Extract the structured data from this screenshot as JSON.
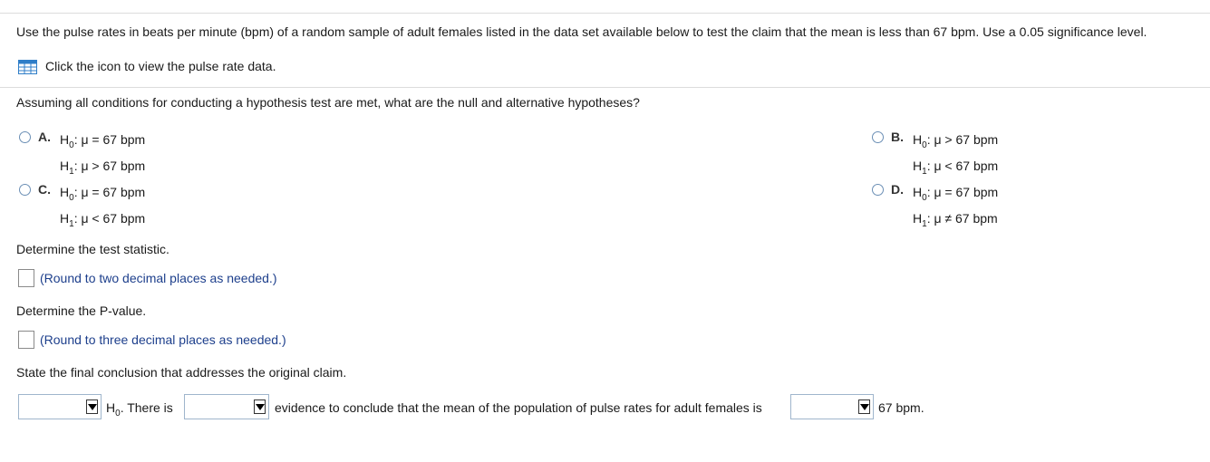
{
  "question": {
    "intro": "Use the pulse rates in beats per minute (bpm) of a random sample of adult females listed in the data set available below to test the claim that the mean is less than 67 bpm. Use a 0.05 significance level.",
    "data_link": "Click the icon to view the pulse rate data.",
    "data_icon": "table-grid-icon"
  },
  "part1": {
    "prompt": "Assuming all conditions for conducting a hypothesis test are met, what are the null and alternative hypotheses?",
    "options": [
      {
        "letter": "A.",
        "h0_rel": "μ = 67 bpm",
        "h1_rel": "μ > 67 bpm"
      },
      {
        "letter": "B.",
        "h0_rel": "μ > 67 bpm",
        "h1_rel": "μ < 67 bpm"
      },
      {
        "letter": "C.",
        "h0_rel": "μ = 67 bpm",
        "h1_rel": "μ < 67 bpm"
      },
      {
        "letter": "D.",
        "h0_rel": "μ = 67 bpm",
        "h1_rel": "μ ≠ 67 bpm"
      }
    ],
    "h0_label": "H",
    "h0_sub": "0",
    "h1_label": "H",
    "h1_sub": "1"
  },
  "part2": {
    "prompt": "Determine the test statistic.",
    "hint": "(Round to two decimal places as needed.)"
  },
  "part3": {
    "prompt": "Determine the P-value.",
    "hint": "(Round to three decimal places as needed.)"
  },
  "part4": {
    "prompt": "State the final conclusion that addresses the original claim.",
    "h_label": "H",
    "h_sub": "0",
    "after_h": ". There is",
    "middle": "evidence to conclude that the mean of the population of pulse rates for adult females is",
    "tail": "67 bpm.",
    "dropdown1_value": "",
    "dropdown2_value": "",
    "dropdown3_value": ""
  }
}
